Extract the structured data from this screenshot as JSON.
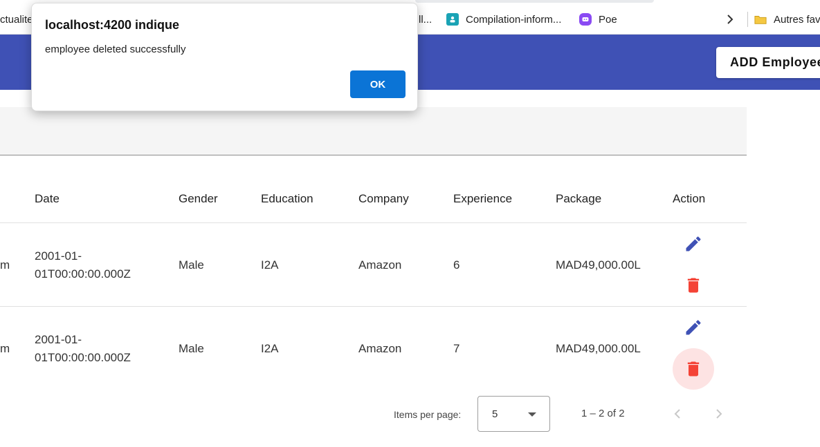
{
  "bookmarks": {
    "items": [
      {
        "label": "ctualite"
      },
      {
        "label": "ll..."
      },
      {
        "label": "Compilation-inform..."
      },
      {
        "label": "Poe"
      },
      {
        "label": "Autres fav"
      }
    ],
    "more_icon": "chevron-right-icon"
  },
  "toolbar": {
    "add_label": "ADD Employee",
    "color": "#3f51b5"
  },
  "table": {
    "headers": [
      "Date",
      "Gender",
      "Education",
      "Company",
      "Experience",
      "Package",
      "Action"
    ],
    "rows": [
      {
        "email_tail": "m",
        "date_line1": "2001-01-",
        "date_line2": "01T00:00:00.000Z",
        "gender": "Male",
        "education": "I2A",
        "company": "Amazon",
        "experience": "6",
        "package": "MAD49,000.00L"
      },
      {
        "email_tail": "m",
        "date_line1": "2001-01-",
        "date_line2": "01T00:00:00.000Z",
        "gender": "Male",
        "education": "I2A",
        "company": "Amazon",
        "experience": "7",
        "package": "MAD49,000.00L"
      }
    ],
    "edit_color": "#3f51b5",
    "delete_color": "#f44336"
  },
  "paginator": {
    "items_per_page_label": "Items per page:",
    "page_size": "5",
    "range_label": "1 – 2 of 2"
  },
  "dialog": {
    "title": "localhost:4200 indique",
    "message": "employee deleted successfully",
    "ok_label": "OK",
    "ok_color": "#0b74d6"
  }
}
